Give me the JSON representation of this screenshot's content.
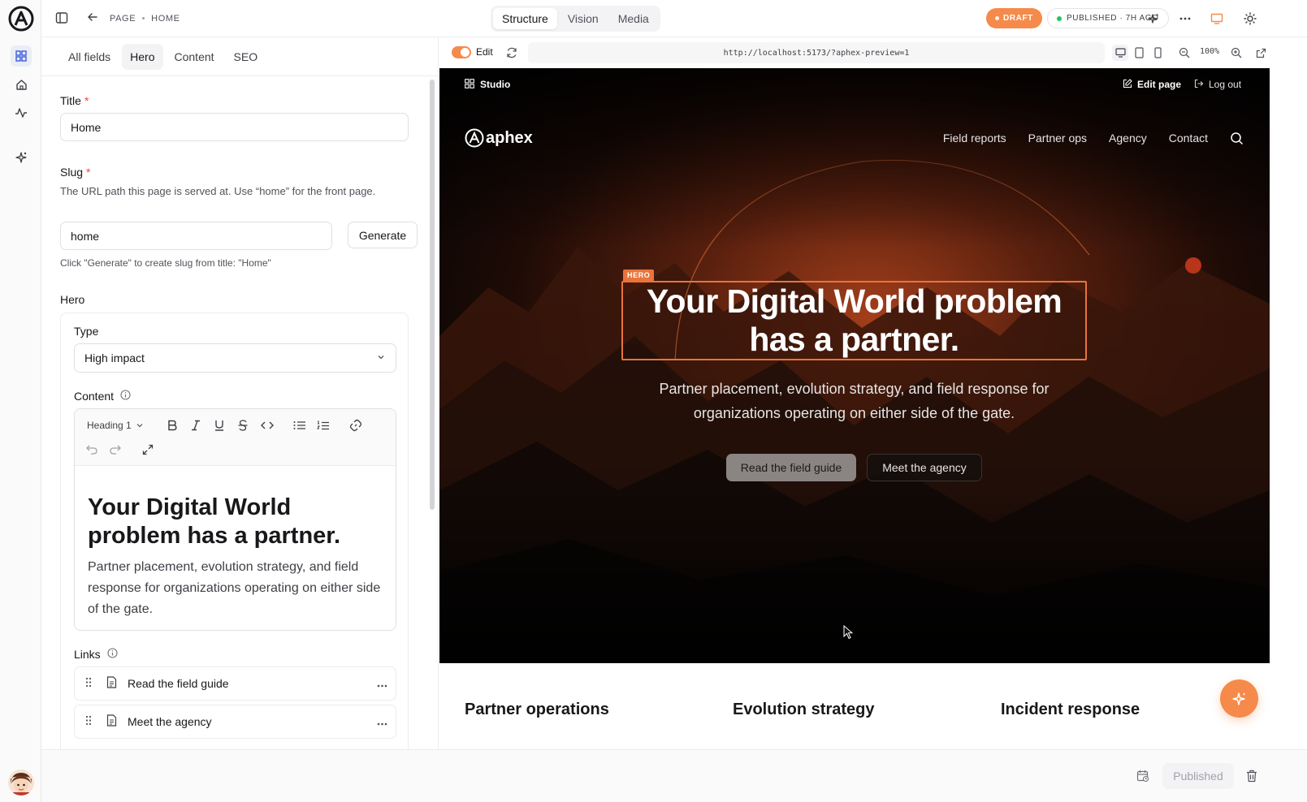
{
  "breadcrumb": {
    "section": "PAGE",
    "page": "HOME"
  },
  "mode_tabs": [
    {
      "label": "Structure",
      "active": true
    },
    {
      "label": "Vision",
      "active": false
    },
    {
      "label": "Media",
      "active": false
    }
  ],
  "status": {
    "draft": "DRAFT",
    "published": "PUBLISHED · 7H AGO"
  },
  "editor": {
    "tabs": [
      {
        "label": "All fields",
        "active": false
      },
      {
        "label": "Hero",
        "active": true
      },
      {
        "label": "Content",
        "active": false
      },
      {
        "label": "SEO",
        "active": false
      }
    ],
    "title_label": "Title",
    "title_value": "Home",
    "slug_label": "Slug",
    "slug_help": "The URL path this page is served at. Use “home” for the front page.",
    "slug_value": "home",
    "generate_label": "Generate",
    "slug_hint": "Click \"Generate\" to create slug from title: \"Home\"",
    "hero_label": "Hero",
    "type_label": "Type",
    "type_value": "High impact",
    "content_label": "Content",
    "heading_select": "Heading 1",
    "content_heading": "Your Digital World problem has a partner.",
    "content_body": "Partner placement, evolution strategy, and field response for organizations operating on either side of the gate.",
    "links_label": "Links",
    "links": [
      {
        "label": "Read the field guide"
      },
      {
        "label": "Meet the agency"
      }
    ]
  },
  "preview": {
    "edit_label": "Edit",
    "url": "http://localhost:5173/?aphex-preview=1",
    "zoom": "100%"
  },
  "site": {
    "studio_label": "Studio",
    "edit_page_label": "Edit page",
    "logout_label": "Log out",
    "brand": "aphex",
    "nav": [
      "Field reports",
      "Partner ops",
      "Agency",
      "Contact"
    ],
    "hero_tag": "HERO",
    "hero_title": "Your Digital World problem has a partner.",
    "hero_subtitle": "Partner placement, evolution strategy, and field response for organizations operating on either side of the gate.",
    "cta_primary": "Read the field guide",
    "cta_secondary": "Meet the agency",
    "columns": [
      "Partner operations",
      "Evolution strategy",
      "Incident response"
    ]
  },
  "footer": {
    "publish_label": "Published"
  },
  "colors": {
    "accent": "#f58a4b",
    "hero_outline": "#e8743b",
    "published_dot": "#22c55e"
  }
}
